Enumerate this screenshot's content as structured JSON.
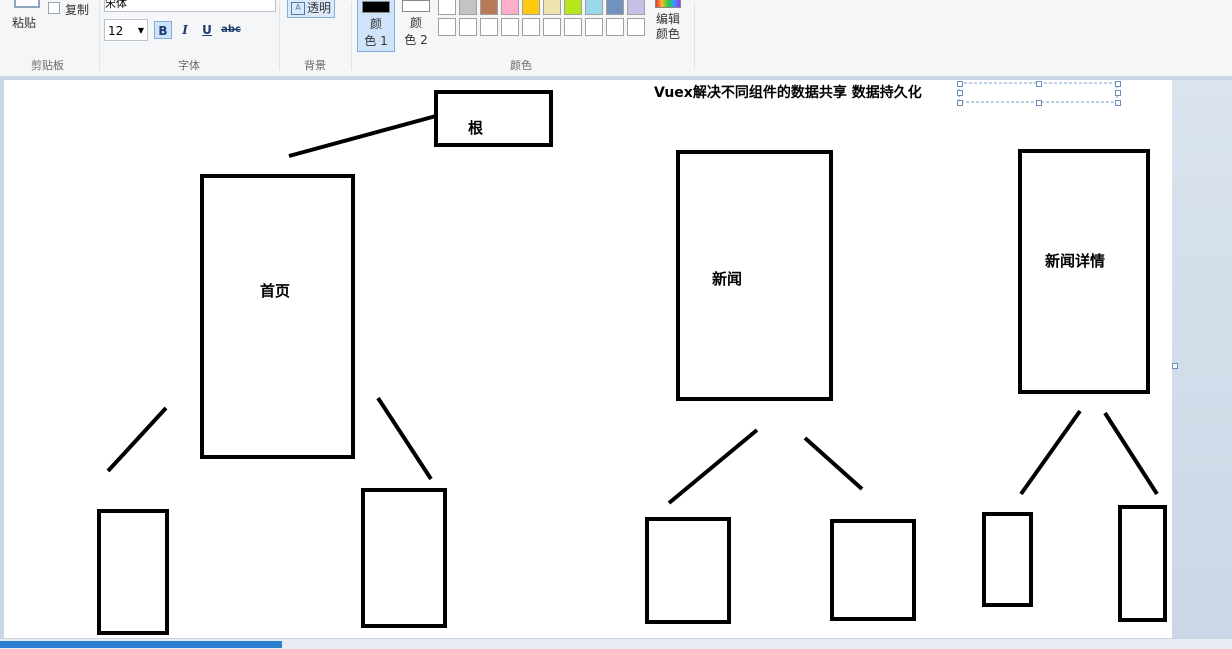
{
  "ribbon": {
    "clipboard": {
      "paste_label": "粘贴",
      "copy_label": "复制",
      "group_label": "剪贴板"
    },
    "font": {
      "family_value": "宋体",
      "size_value": "12",
      "bold_label": "B",
      "italic_label": "I",
      "underline_label": "U",
      "strike_label": "abc",
      "group_label": "字体"
    },
    "background": {
      "transparent_label": "透明",
      "group_label": "背景"
    },
    "colors": {
      "color1_label": "颜色 1",
      "color1_line1": "颜",
      "color1_line2": "色 1",
      "color2_line1": "颜",
      "color2_line2": "色 2",
      "color1_value": "#000000",
      "color2_value": "#ffffff",
      "palette_row1": [
        "#ffffff",
        "#c3c3c3",
        "#b97a57",
        "#ffaec9",
        "#ffc90e",
        "#efe4b0",
        "#b5e61d",
        "#99d9ea",
        "#7092be",
        "#c8bfe7"
      ],
      "palette_row2": [
        "#ffffff",
        "#ffffff",
        "#ffffff",
        "#ffffff",
        "#ffffff",
        "#ffffff",
        "#ffffff",
        "#ffffff",
        "#ffffff",
        "#ffffff"
      ],
      "edit_line1": "编辑",
      "edit_line2": "颜色",
      "group_label": "颜色"
    }
  },
  "canvas": {
    "title": "Vuex解决不同组件的数据共享 数据持久化",
    "root_label": "根",
    "home_label": "首页",
    "news_label": "新闻",
    "news_detail_label": "新闻详情"
  }
}
